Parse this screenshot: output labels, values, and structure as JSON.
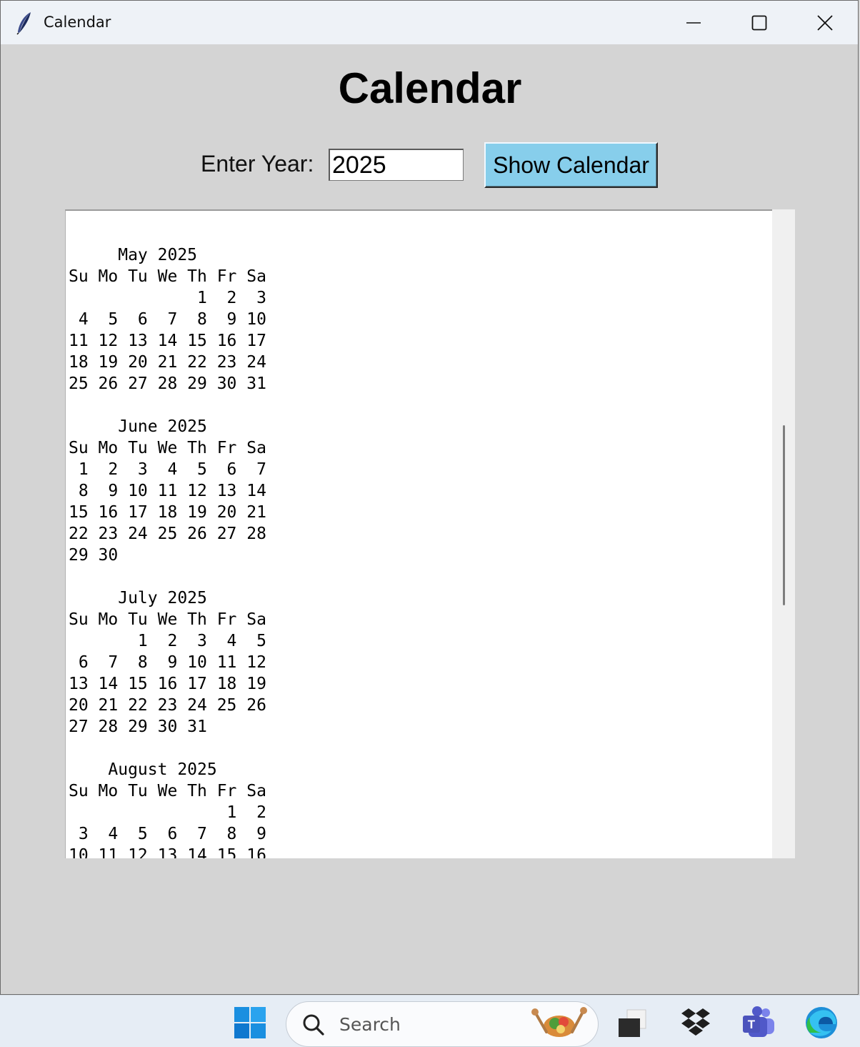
{
  "window": {
    "title": "Calendar"
  },
  "app": {
    "heading": "Calendar",
    "year_label": "Enter Year:",
    "year_value": "2025",
    "show_button_label": "Show Calendar",
    "calendar_text": "\n     May 2025\nSu Mo Tu We Th Fr Sa\n             1  2  3\n 4  5  6  7  8  9 10\n11 12 13 14 15 16 17\n18 19 20 21 22 23 24\n25 26 27 28 29 30 31\n\n     June 2025\nSu Mo Tu We Th Fr Sa\n 1  2  3  4  5  6  7\n 8  9 10 11 12 13 14\n15 16 17 18 19 20 21\n22 23 24 25 26 27 28\n29 30\n\n     July 2025\nSu Mo Tu We Th Fr Sa\n       1  2  3  4  5\n 6  7  8  9 10 11 12\n13 14 15 16 17 18 19\n20 21 22 23 24 25 26\n27 28 29 30 31\n\n    August 2025\nSu Mo Tu We Th Fr Sa\n                1  2\n 3  4  5  6  7  8  9\n10 11 12 13 14 15 16"
  },
  "taskbar": {
    "search_placeholder": "Search",
    "icons": [
      "windows-start-icon",
      "search-icon",
      "task-view-icon",
      "dropbox-icon",
      "teams-icon",
      "edge-icon"
    ]
  },
  "colors": {
    "window_bg": "#d4d4d4",
    "titlebar_bg": "#eef2f7",
    "button_bg": "#87ceeb",
    "text_area_bg": "#ffffff",
    "taskbar_bg": "#e6edf5",
    "windows_blue": "#0078d4"
  }
}
